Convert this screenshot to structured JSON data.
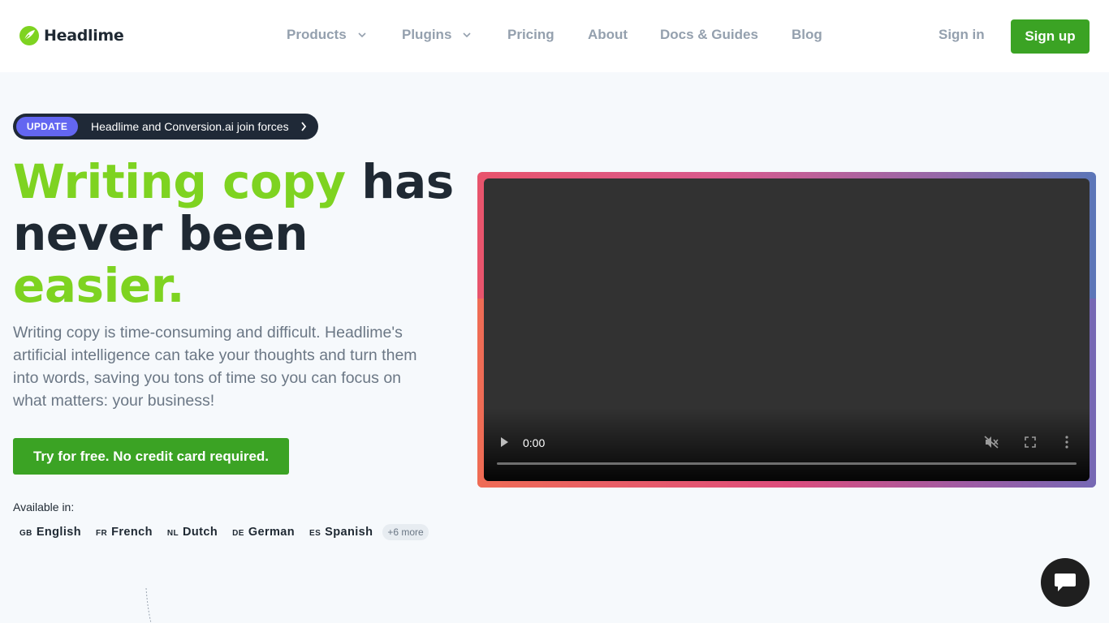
{
  "brand": {
    "name": "Headlime",
    "logo_color": "#7ed321"
  },
  "nav": {
    "items": [
      {
        "label": "Products",
        "has_dropdown": true
      },
      {
        "label": "Plugins",
        "has_dropdown": true
      },
      {
        "label": "Pricing",
        "has_dropdown": false
      },
      {
        "label": "About",
        "has_dropdown": false
      },
      {
        "label": "Docs & Guides",
        "has_dropdown": false
      },
      {
        "label": "Blog",
        "has_dropdown": false
      }
    ],
    "signin_label": "Sign in",
    "signup_label": "Sign up"
  },
  "announcement": {
    "badge": "UPDATE",
    "text": "Headlime and Conversion.ai join forces",
    "icon": "chevron-right-icon"
  },
  "hero": {
    "headline_green_1": "Writing copy",
    "headline_dark": " has never been ",
    "headline_green_2": "easier.",
    "subtext": "Writing copy is time-consuming and difficult. Headlime's artificial intelligence can take your thoughts and turn them into words, saving you tons of time so you can focus on what matters: your business!",
    "cta_label": "Try for free. No credit card required."
  },
  "availability": {
    "label": "Available in:",
    "languages": [
      {
        "code": "GB",
        "name": "English"
      },
      {
        "code": "FR",
        "name": "French"
      },
      {
        "code": "NL",
        "name": "Dutch"
      },
      {
        "code": "DE",
        "name": "German"
      },
      {
        "code": "ES",
        "name": "Spanish"
      }
    ],
    "more_label": "+6 more"
  },
  "video": {
    "current_time": "0:00",
    "muted": true,
    "progress": 0
  },
  "colors": {
    "accent_green": "#3ba324",
    "headline_green": "#7ed321",
    "badge_purple": "#6366f1",
    "text_dark": "#1f2933",
    "nav_gray": "#94a0ae"
  }
}
